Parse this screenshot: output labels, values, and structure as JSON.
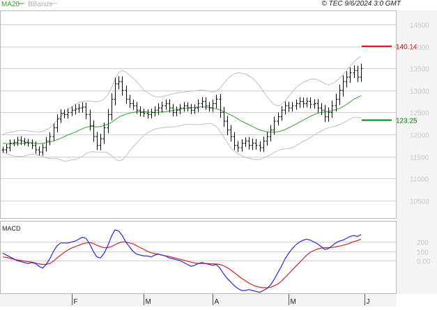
{
  "header": {
    "ma_label": "MA20",
    "bb_label": "BBands",
    "timestamp": "© TEC 9/6/2024 3:0 GMT"
  },
  "colors": {
    "price_bar": "#000000",
    "ma20": "#2fa52f",
    "bbands": "#c0c0c0",
    "macd": "#2727d9",
    "signal": "#d22424",
    "resistance": "#cc0000",
    "support": "#008000",
    "grid": "#d0d0d0",
    "background": "#ffffff",
    "axis_band": "#f2f2f2"
  },
  "chart_data": [
    {
      "type": "ohlc",
      "panel": "price",
      "y_ticks": [
        10500,
        11000,
        11500,
        12000,
        12500,
        13000,
        13500,
        14000,
        14500
      ],
      "y_tick_labels": [
        "10500",
        "11000",
        "11500",
        "12000",
        "12500",
        "13000",
        "13500",
        "14000",
        "14500"
      ],
      "ylim": [
        10100,
        14800
      ],
      "x_range": [
        0,
        101
      ],
      "month_labels": [
        {
          "index": 19,
          "label": "F"
        },
        {
          "index": 39,
          "label": "M"
        },
        {
          "index": 58,
          "label": "A"
        },
        {
          "index": 79,
          "label": "M"
        },
        {
          "index": 100,
          "label": "J"
        }
      ],
      "close": [
        11650,
        11700,
        11800,
        11820,
        11870,
        11850,
        11820,
        11800,
        11750,
        11650,
        11600,
        11700,
        11850,
        11950,
        12150,
        12350,
        12480,
        12450,
        12500,
        12550,
        12580,
        12600,
        12620,
        12450,
        12200,
        11950,
        11750,
        11900,
        12150,
        12450,
        12800,
        13150,
        13200,
        13000,
        12800,
        12700,
        12650,
        12550,
        12500,
        12480,
        12450,
        12500,
        12550,
        12600,
        12650,
        12700,
        12600,
        12500,
        12550,
        12600,
        12650,
        12600,
        12550,
        12600,
        12700,
        12750,
        12650,
        12600,
        12700,
        12800,
        12500,
        12300,
        12100,
        11950,
        11750,
        11700,
        11800,
        11850,
        11750,
        11800,
        11750,
        11700,
        11850,
        11950,
        12100,
        12300,
        12400,
        12550,
        12650,
        12600,
        12650,
        12700,
        12750,
        12700,
        12750,
        12680,
        12700,
        12600,
        12550,
        12400,
        12500,
        12650,
        12800,
        13000,
        13200,
        13300,
        13400,
        13450,
        13300,
        13500
      ],
      "range": [
        200,
        220,
        240,
        200,
        220,
        260,
        200,
        220,
        240,
        260,
        220,
        240,
        260,
        280,
        280,
        300,
        260,
        240,
        260,
        240,
        280,
        260,
        300,
        300,
        320,
        340,
        300,
        320,
        340,
        360,
        380,
        400,
        360,
        340,
        300,
        280,
        260,
        240,
        260,
        240,
        260,
        240,
        260,
        300,
        280,
        260,
        280,
        260,
        240,
        260,
        240,
        220,
        260,
        240,
        260,
        280,
        260,
        240,
        260,
        300,
        340,
        360,
        340,
        320,
        300,
        280,
        260,
        240,
        260,
        300,
        280,
        260,
        280,
        300,
        320,
        300,
        280,
        260,
        280,
        260,
        240,
        260,
        280,
        260,
        240,
        260,
        280,
        300,
        320,
        340,
        320,
        340,
        360,
        380,
        400,
        380,
        360,
        340,
        320,
        300
      ],
      "ma20": [
        11800,
        11790,
        11785,
        11780,
        11790,
        11800,
        11800,
        11810,
        11810,
        11800,
        11790,
        11800,
        11810,
        11830,
        11850,
        11880,
        11910,
        11950,
        11990,
        12020,
        12050,
        12090,
        12130,
        12160,
        12180,
        12180,
        12170,
        12180,
        12200,
        12230,
        12270,
        12330,
        12390,
        12430,
        12460,
        12480,
        12500,
        12510,
        12520,
        12520,
        12510,
        12500,
        12500,
        12500,
        12510,
        12520,
        12530,
        12540,
        12560,
        12580,
        12590,
        12600,
        12610,
        12610,
        12620,
        12630,
        12620,
        12610,
        12600,
        12580,
        12560,
        12520,
        12480,
        12440,
        12400,
        12350,
        12300,
        12260,
        12220,
        12180,
        12140,
        12100,
        12080,
        12060,
        12050,
        12050,
        12060,
        12080,
        12110,
        12150,
        12190,
        12230,
        12280,
        12320,
        12370,
        12410,
        12450,
        12480,
        12500,
        12510,
        12520,
        12540,
        12560,
        12590,
        12630,
        12680,
        12740,
        12800,
        12840,
        12880
      ],
      "bb_upper": [
        12000,
        12030,
        12050,
        12060,
        12080,
        12090,
        12090,
        12080,
        12070,
        12060,
        12050,
        12070,
        12100,
        12150,
        12220,
        12320,
        12420,
        12500,
        12560,
        12620,
        12680,
        12720,
        12750,
        12760,
        12760,
        12750,
        12740,
        12760,
        12800,
        12900,
        13050,
        13250,
        13400,
        13450,
        13420,
        13350,
        13280,
        13200,
        13100,
        13000,
        12950,
        12900,
        12860,
        12850,
        12860,
        12880,
        12900,
        12920,
        12940,
        12950,
        12960,
        12970,
        12980,
        12990,
        13000,
        13010,
        13000,
        12980,
        12960,
        12980,
        13050,
        13150,
        13250,
        13330,
        13380,
        13400,
        13390,
        13370,
        13330,
        13280,
        13200,
        13100,
        12980,
        12860,
        12760,
        12680,
        12650,
        12680,
        12760,
        12860,
        12960,
        13060,
        13130,
        13180,
        13220,
        13250,
        13260,
        13240,
        13200,
        13150,
        13130,
        13150,
        13200,
        13270,
        13360,
        13450,
        13560,
        13650,
        13720,
        13780
      ],
      "bb_lower": [
        11600,
        11560,
        11530,
        11510,
        11500,
        11500,
        11510,
        11530,
        11550,
        11540,
        11520,
        11500,
        11470,
        11450,
        11450,
        11450,
        11420,
        11390,
        11400,
        11420,
        11430,
        11460,
        11500,
        11560,
        11600,
        11610,
        11600,
        11600,
        11600,
        11580,
        11520,
        11450,
        11400,
        11420,
        11500,
        11620,
        11720,
        11800,
        11900,
        11980,
        12040,
        12080,
        12120,
        12140,
        12150,
        12160,
        12170,
        12170,
        12180,
        12200,
        12220,
        12230,
        12230,
        12220,
        12220,
        12230,
        12240,
        12250,
        12230,
        12180,
        12080,
        11950,
        11820,
        11700,
        11620,
        11560,
        11520,
        11480,
        11460,
        11440,
        11430,
        11430,
        11460,
        11500,
        11540,
        11590,
        11630,
        11660,
        11670,
        11680,
        11700,
        11740,
        11790,
        11840,
        11880,
        11930,
        11980,
        12030,
        12080,
        12120,
        12150,
        12170,
        12190,
        12220,
        12260,
        12300,
        12350,
        12390,
        12390,
        12380
      ],
      "levels": [
        {
          "name": "resistance",
          "value": 14014,
          "label": "140.14"
        },
        {
          "name": "support",
          "value": 12325,
          "label": "123.25"
        }
      ]
    },
    {
      "type": "line",
      "panel": "macd",
      "title": "MACD",
      "y_ticks": [
        0,
        100,
        200
      ],
      "y_tick_labels": [
        "0.00",
        "100",
        "200"
      ],
      "ylim": [
        -350,
        420
      ],
      "series": [
        {
          "name": "MACD",
          "values": [
            80,
            60,
            40,
            20,
            0,
            -10,
            -20,
            -30,
            -20,
            -30,
            -60,
            -80,
            -40,
            20,
            100,
            160,
            190,
            190,
            190,
            200,
            210,
            230,
            250,
            240,
            180,
            100,
            40,
            30,
            80,
            160,
            260,
            330,
            320,
            270,
            200,
            150,
            100,
            70,
            60,
            50,
            50,
            40,
            60,
            70,
            60,
            50,
            30,
            20,
            10,
            0,
            -20,
            -40,
            -60,
            -50,
            -30,
            -20,
            -30,
            -40,
            -50,
            -40,
            -80,
            -140,
            -190,
            -230,
            -270,
            -300,
            -320,
            -320,
            -310,
            -320,
            -330,
            -340,
            -320,
            -300,
            -260,
            -200,
            -130,
            -60,
            20,
            80,
            130,
            170,
            200,
            220,
            230,
            220,
            200,
            180,
            150,
            120,
            130,
            160,
            190,
            210,
            220,
            240,
            260,
            270,
            260,
            280
          ]
        },
        {
          "name": "Signal",
          "values": [
            40,
            35,
            25,
            15,
            8,
            2,
            -5,
            -10,
            -15,
            -25,
            -35,
            -40,
            -40,
            -30,
            -5,
            30,
            60,
            90,
            115,
            135,
            150,
            165,
            180,
            190,
            195,
            185,
            165,
            150,
            140,
            140,
            150,
            170,
            190,
            200,
            200,
            190,
            180,
            160,
            140,
            120,
            100,
            85,
            75,
            70,
            60,
            50,
            45,
            35,
            25,
            15,
            5,
            -5,
            -15,
            -25,
            -30,
            -30,
            -30,
            -32,
            -34,
            -36,
            -40,
            -55,
            -75,
            -100,
            -130,
            -160,
            -190,
            -215,
            -240,
            -260,
            -275,
            -285,
            -290,
            -290,
            -285,
            -270,
            -250,
            -220,
            -180,
            -140,
            -100,
            -60,
            -20,
            20,
            60,
            90,
            110,
            125,
            135,
            140,
            140,
            142,
            148,
            155,
            165,
            175,
            190,
            205,
            215,
            230
          ]
        }
      ]
    }
  ]
}
